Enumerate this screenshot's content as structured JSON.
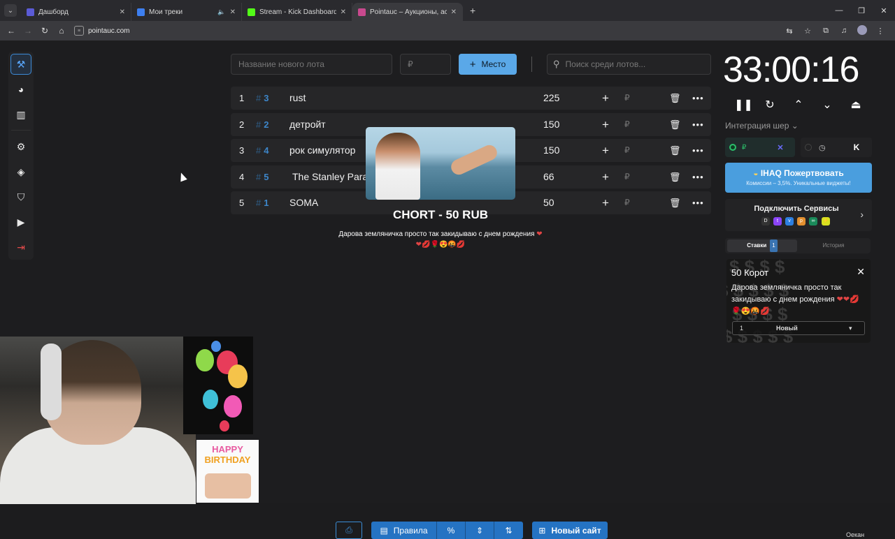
{
  "browser": {
    "tabs": [
      {
        "title": "Дашборд",
        "color": "#5b5bd6"
      },
      {
        "title": "Мои треки",
        "color": "#3d7ff0",
        "audio": "🔈"
      },
      {
        "title": "Stream - Kick Dashboard",
        "color": "#53fc18"
      },
      {
        "title": "Pointauc – Аукционы, астероиды",
        "color": "#c9498e"
      }
    ],
    "url": "pointauc.com"
  },
  "toolbar": {
    "new_lot_placeholder": "Название нового лота",
    "amount_placeholder": "₽",
    "place_button": "Место",
    "search_placeholder": "Поиск среди лотов..."
  },
  "lots": [
    {
      "num": "1",
      "id": "3",
      "name": "rust",
      "amount": "225"
    },
    {
      "num": "2",
      "id": "2",
      "name": "детройт",
      "amount": "150"
    },
    {
      "num": "3",
      "id": "4",
      "name": "рок симулятор",
      "amount": "150"
    },
    {
      "num": "4",
      "id": "5",
      "name": "The Stanley Para",
      "amount": "66"
    },
    {
      "num": "5",
      "id": "1",
      "name": "SOMA",
      "amount": "50"
    }
  ],
  "row_labels": {
    "hash": "#",
    "rub": "₽"
  },
  "donation": {
    "title": "CHORT - 50 RUB",
    "message": "Дарова земляничка просто так закидываю с днем рождения",
    "emojis": "❤💋🌹😍🤬💋"
  },
  "timer": {
    "value": "33:00:16"
  },
  "integrations": {
    "label": "Интеграция шер",
    "rub": "₽"
  },
  "donate_banner": {
    "title": "IHAQ Пожертвовать",
    "subtitle": "Комиссии – 3,5%. Уникальные виджеты!"
  },
  "services": {
    "title": "Подключить Сервисы"
  },
  "bids_tabs": {
    "bids": "Ставки",
    "bids_count": "1",
    "history": "История"
  },
  "bid_card": {
    "title": "50 Корот",
    "message": "Дарова земляничка просто так закидываю с днем рождения",
    "emojis": "❤❤💋🌹😍🤬💋",
    "select_num": "1",
    "select_value": "Новый"
  },
  "bottom": {
    "rules": "Правила",
    "new_site": "Новый сайт"
  },
  "bday": {
    "line1": "HAPPY",
    "line2": "BIRTHDAY"
  },
  "footer": {
    "name": "Оекан"
  },
  "colors": {
    "accent": "#3d86c9",
    "button": "#5aa8e8",
    "bottom_bar": "#2573c3"
  }
}
